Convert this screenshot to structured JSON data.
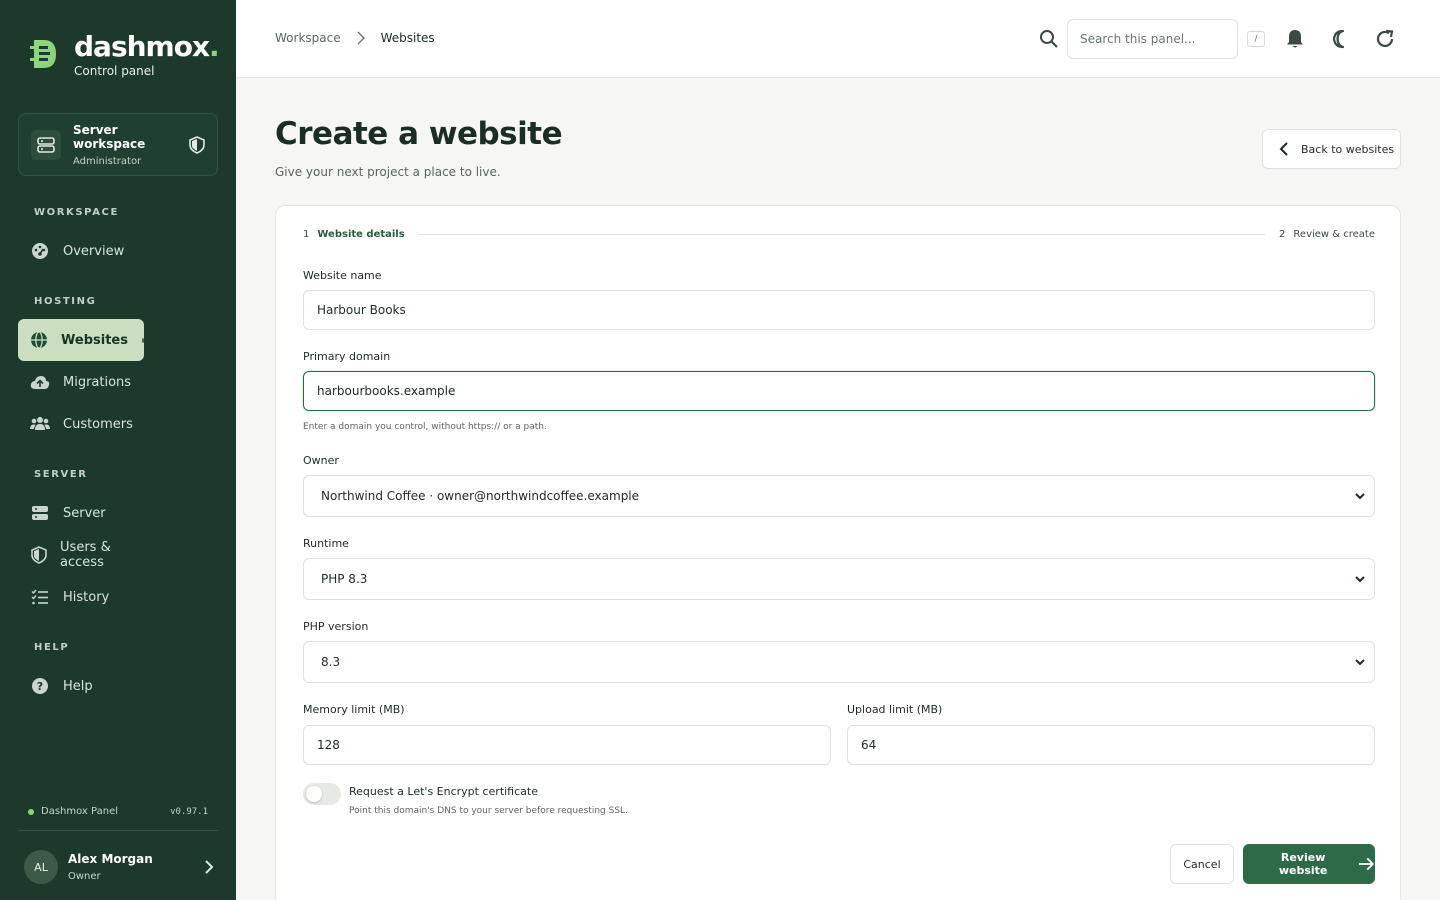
{
  "brand": {
    "name": "dashmox",
    "dot": ".",
    "subtitle": "Control panel"
  },
  "workspace_card": {
    "title": "Server workspace",
    "role": "Administrator"
  },
  "sidebar": {
    "sections": [
      "WORKSPACE",
      "HOSTING",
      "SERVER",
      "HELP"
    ],
    "items": [
      {
        "label": "Overview",
        "icon": "dashboard-gauge-icon"
      },
      {
        "label": "Websites",
        "icon": "globe-icon",
        "active": true
      },
      {
        "label": "Migrations",
        "icon": "cloud-upload-icon"
      },
      {
        "label": "Customers",
        "icon": "users-icon"
      },
      {
        "label": "Server",
        "icon": "server-icon"
      },
      {
        "label": "Users & access",
        "icon": "shield-icon"
      },
      {
        "label": "History",
        "icon": "list-check-icon"
      },
      {
        "label": "Help",
        "icon": "help-circle-icon"
      }
    ],
    "status": {
      "label": "Dashmox Panel",
      "version": "v0.97.1"
    },
    "user": {
      "initials": "AL",
      "name": "Alex Morgan",
      "role": "Owner"
    }
  },
  "topbar": {
    "breadcrumb": [
      "Workspace",
      "Websites"
    ],
    "search_placeholder": "Search this panel...",
    "shortcut": "/"
  },
  "page": {
    "title": "Create a website",
    "subtitle": "Give your next project a place to live.",
    "back_label": "Back to websites"
  },
  "steps": [
    {
      "num": "1",
      "label": "Website details",
      "active": true
    },
    {
      "num": "2",
      "label": "Review & create",
      "active": false
    }
  ],
  "form": {
    "website_name": {
      "label": "Website name",
      "value": "Harbour Books"
    },
    "primary_domain": {
      "label": "Primary domain",
      "value": "harbourbooks.example",
      "hint": "Enter a domain you control, without https:// or a path."
    },
    "owner": {
      "label": "Owner",
      "value": "Northwind Coffee · owner@northwindcoffee.example"
    },
    "runtime": {
      "label": "Runtime",
      "value": "PHP 8.3"
    },
    "php_version": {
      "label": "PHP version",
      "value": "8.3"
    },
    "memory_limit": {
      "label": "Memory limit (MB)",
      "value": "128"
    },
    "upload_limit": {
      "label": "Upload limit (MB)",
      "value": "64"
    },
    "ssl": {
      "label": "Request a Let's Encrypt certificate",
      "hint": "Point this domain's DNS to your server before requesting SSL.",
      "enabled": false
    }
  },
  "actions": {
    "cancel": "Cancel",
    "primary": "Review website"
  },
  "colors": {
    "sidebar": "#1b3a2b",
    "accent": "#2d6b48",
    "active_nav": "#c9dfbf",
    "logo": "#8fd47a"
  }
}
